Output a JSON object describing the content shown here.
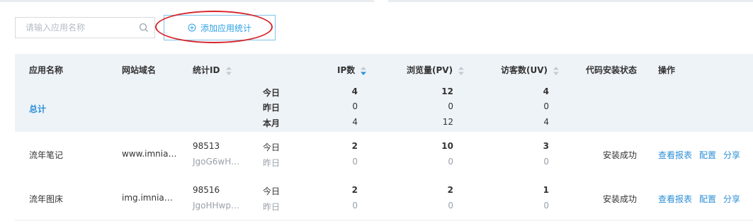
{
  "toolbar": {
    "search_placeholder": "请输入应用名称",
    "add_button_label": "添加应用统计"
  },
  "table": {
    "columns": {
      "app_name": "应用名称",
      "domain": "网站域名",
      "stat_id": "统计ID",
      "ip": "IP数",
      "pv": "浏览量(PV)",
      "uv": "访客数(UV)",
      "status": "代码安装状态",
      "actions": "操作"
    },
    "total": {
      "label": "总计",
      "periods": [
        "今日",
        "昨日",
        "本月"
      ],
      "ip": [
        "4",
        "0",
        "4"
      ],
      "pv": [
        "12",
        "0",
        "12"
      ],
      "uv": [
        "4",
        "0",
        "4"
      ]
    },
    "rows": [
      {
        "name": "流年笔记",
        "domain": "www.imnia…",
        "id": "98513",
        "code": "JgoG6wH…",
        "periods": [
          "今日",
          "昨日"
        ],
        "ip": [
          "2",
          "0"
        ],
        "pv": [
          "10",
          "0"
        ],
        "uv": [
          "3",
          "0"
        ],
        "status": "安装成功",
        "actions": [
          "查看报表",
          "配置",
          "分享"
        ]
      },
      {
        "name": "流年图床",
        "domain": "img.imnia…",
        "id": "98516",
        "code": "JgoHHwp…",
        "periods": [
          "今日",
          "昨日"
        ],
        "ip": [
          "2",
          "0"
        ],
        "pv": [
          "2",
          "0"
        ],
        "uv": [
          "1",
          "0"
        ],
        "status": "安装成功",
        "actions": [
          "查看报表",
          "配置",
          "分享"
        ]
      }
    ]
  },
  "colors": {
    "accent": "#2ea1e6",
    "link": "#2d8fd5",
    "header_bg": "#eef3f8",
    "annotation": "#d7262b"
  },
  "icons": [
    "search-icon",
    "plus-circle-icon",
    "sort-icon"
  ]
}
